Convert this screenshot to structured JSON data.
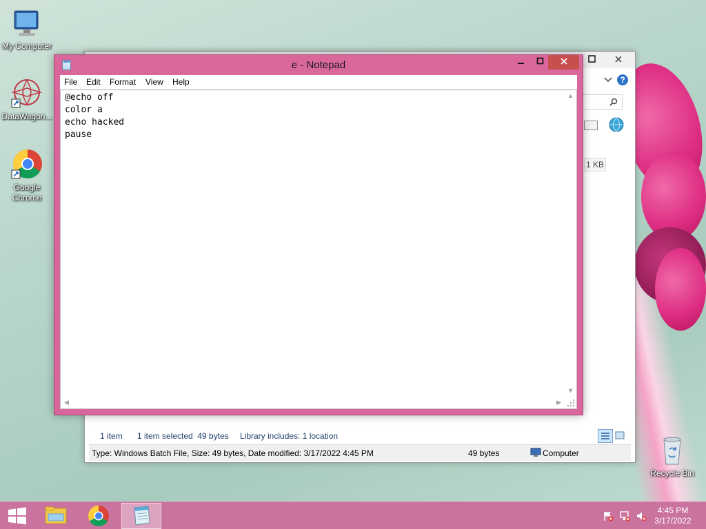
{
  "desktop": {
    "icons": [
      {
        "label": "My Computer",
        "icon": "monitor-icon"
      },
      {
        "label": "DataWagon...",
        "icon": "datawagon-icon"
      },
      {
        "label": "Google Chrome",
        "icon": "chrome-icon"
      },
      {
        "label": "Recycle Bin",
        "icon": "recycle-bin-icon"
      }
    ]
  },
  "explorer": {
    "size_value": "1 KB",
    "status_bar": {
      "item_count": "1 item",
      "selection": "1 item selected  49 bytes",
      "library": "Library includes: 1 location"
    },
    "details_bar": {
      "info": "Type: Windows Batch File, Size: 49 bytes, Date modified: 3/17/2022 4:45 PM",
      "size": "49 bytes",
      "location": "Computer"
    }
  },
  "notepad": {
    "title": "e - Notepad",
    "menu": [
      "File",
      "Edit",
      "Format",
      "View",
      "Help"
    ],
    "content": "@echo off\ncolor a\necho hacked\npause"
  },
  "taskbar": {
    "pinned": [
      "file-explorer-icon",
      "chrome-icon",
      "notepad-icon"
    ],
    "clock": {
      "time": "4:45 PM",
      "date": "3/17/2022"
    }
  },
  "colors": {
    "notepad_frame": "#d9679c",
    "taskbar": "#c9739e",
    "close_button": "#c7504f"
  }
}
